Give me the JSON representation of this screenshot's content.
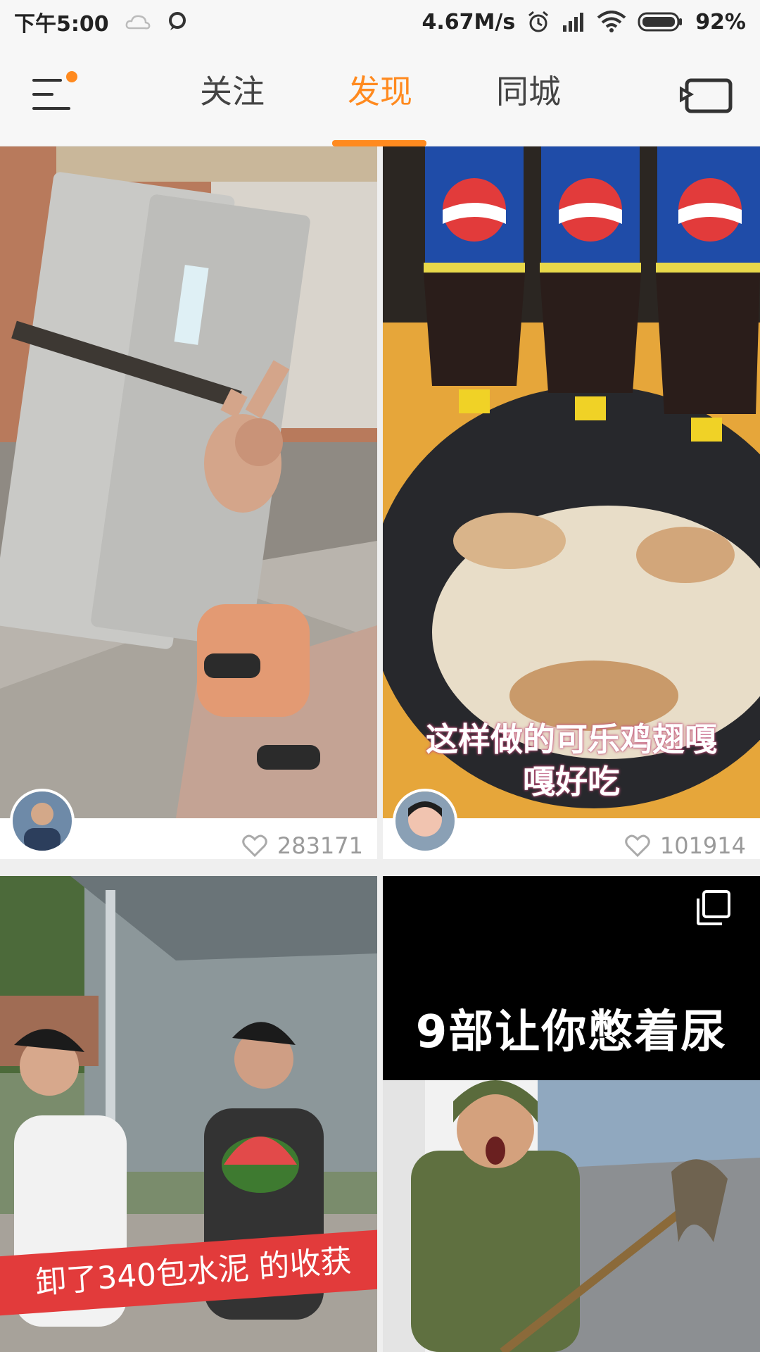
{
  "status_bar": {
    "time": "下午5:00",
    "network_speed": "4.67M/s",
    "battery": "92%"
  },
  "nav": {
    "tabs": [
      {
        "label": "关注",
        "active": false
      },
      {
        "label": "发现",
        "active": true
      },
      {
        "label": "同城",
        "active": false
      }
    ],
    "accent_color": "#ff8a1f",
    "menu_icon": "menu-icon",
    "cast_icon": "cast-icon"
  },
  "feed": {
    "cards": [
      {
        "likes": "283171",
        "caption": ""
      },
      {
        "likes": "101914",
        "caption": "这样做的可乐鸡翅嘎嘎好吃"
      },
      {
        "caption": "卸了340包水泥 的收获"
      },
      {
        "caption": "9部让你憋着尿"
      }
    ]
  },
  "caption_lines": {
    "card2_line1": "这样做的可乐鸡翅嘎",
    "card2_line2": "嘎好吃"
  }
}
